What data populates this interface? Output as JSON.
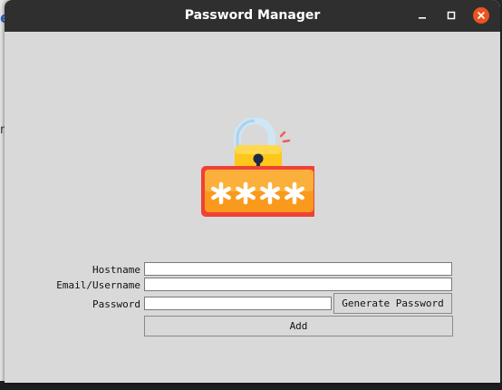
{
  "window": {
    "title": "Password Manager"
  },
  "background": {
    "left_glyph_1": "e",
    "left_glyph_2": "n"
  },
  "form": {
    "hostname_label": "Hostname",
    "email_label": "Email/Username",
    "password_label": "Password",
    "hostname_value": "",
    "email_value": "",
    "password_value": "",
    "generate_button_label": "Generate Password",
    "add_button_label": "Add"
  },
  "icons": {
    "logo": "padlock-password-icon",
    "minimize": "minimize-icon",
    "maximize": "maximize-icon",
    "close": "close-icon"
  },
  "colors": {
    "titlebar": "#2f2f2f",
    "window_bg": "#d9d9d9",
    "close_button": "#e95420",
    "lock_body": "#ffc61b",
    "password_panel": "#f55a23"
  }
}
